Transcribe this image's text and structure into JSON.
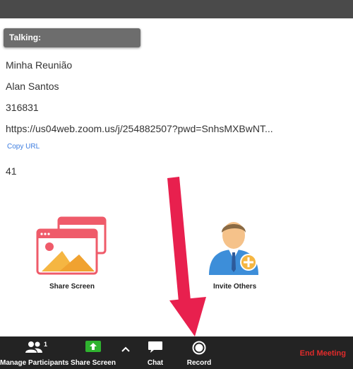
{
  "talking_label": "Talking:",
  "meeting": {
    "topic": "Minha Reunião",
    "host": "Alan Santos",
    "meeting_id": "316831",
    "url": "https://us04web.zoom.us/j/254882507?pwd=SnhsMXBwNT...",
    "copy_url_label": "Copy URL",
    "participant_id": "41"
  },
  "tiles": {
    "share_screen_label": "Share Screen",
    "invite_others_label": "Invite Others"
  },
  "toolbar": {
    "manage_participants_label": "Manage Participants",
    "participants_count": "1",
    "share_screen_label": "Share Screen",
    "chat_label": "Chat",
    "record_label": "Record",
    "end_meeting_label": "End Meeting"
  },
  "colors": {
    "share_green": "#2fb32f",
    "end_meeting_red": "#e02b2b",
    "arrow_red": "#e8204e",
    "link_blue": "#3d7de0"
  }
}
